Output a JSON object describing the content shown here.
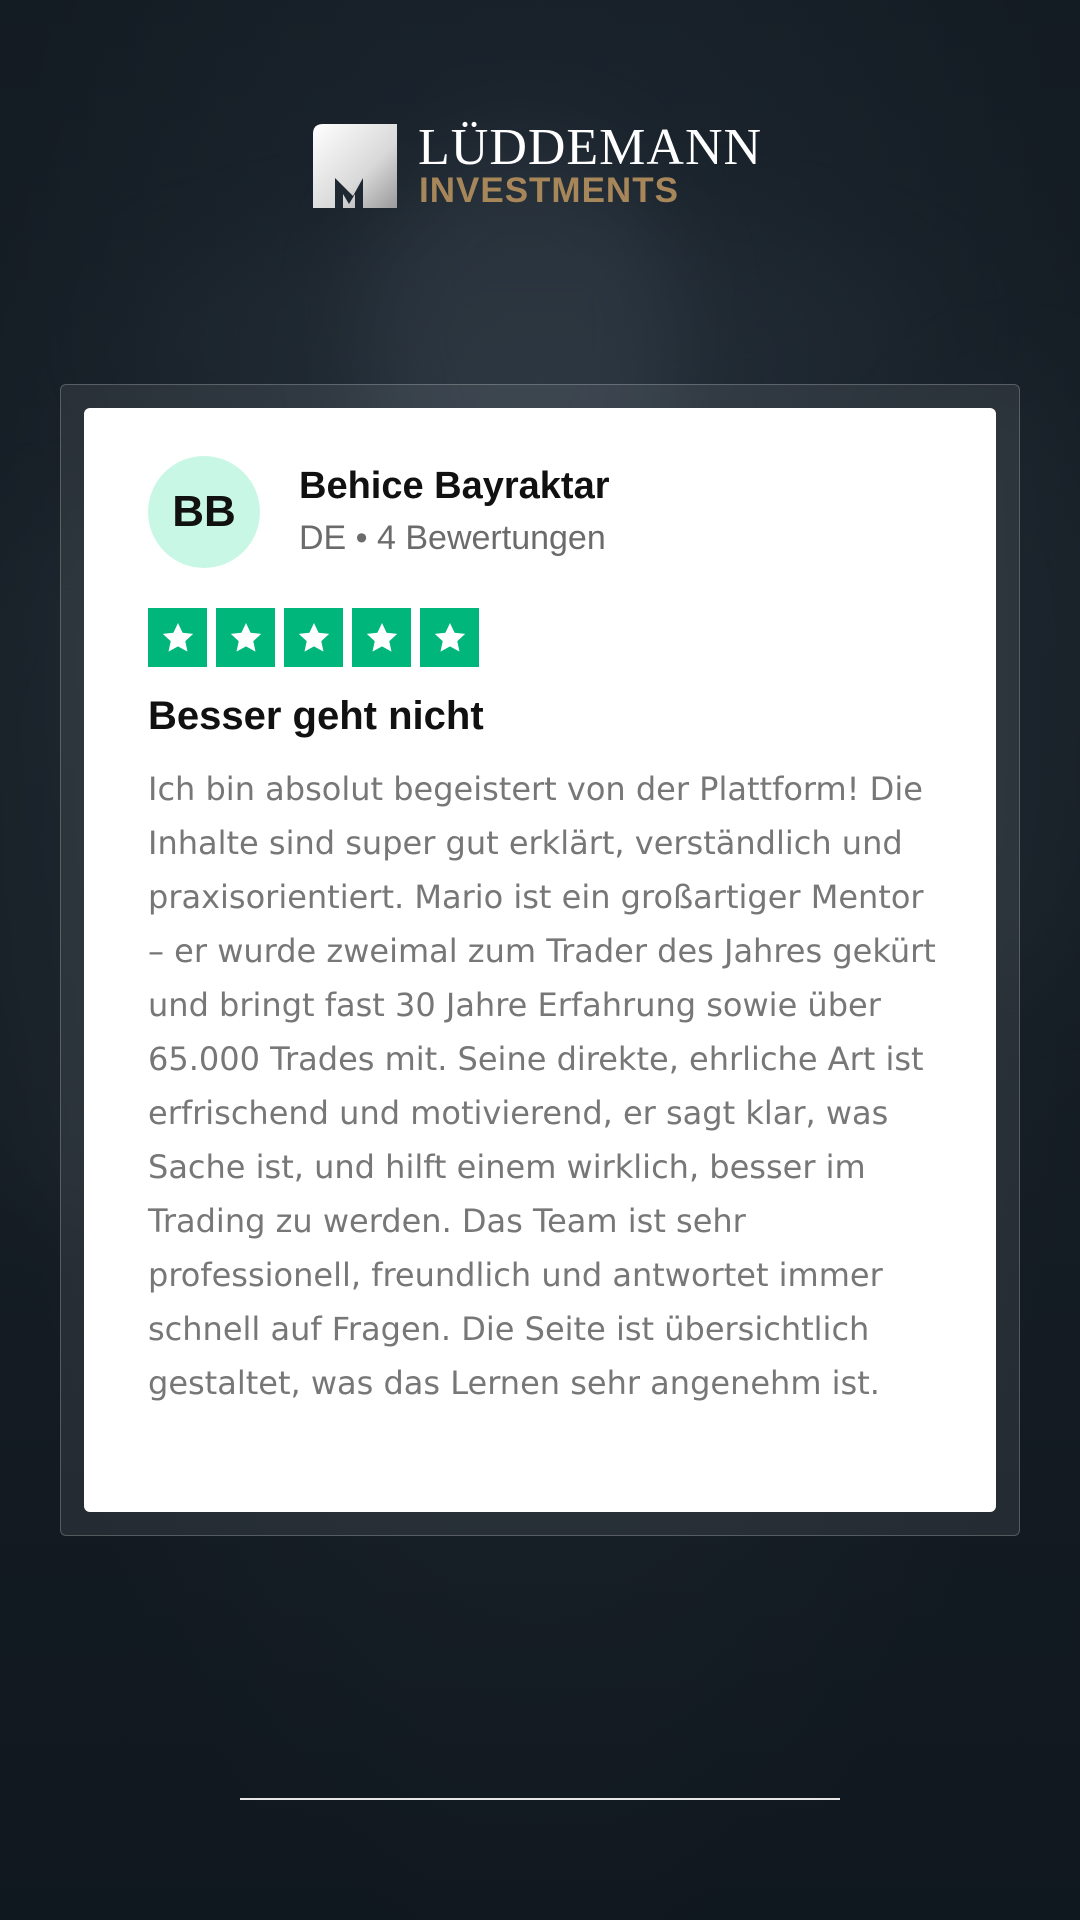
{
  "brand": {
    "name": "LÜDDEMANN",
    "subline": "INVESTMENTS",
    "accent_color": "#a7875a"
  },
  "review": {
    "avatar_initials": "BB",
    "reviewer_name": "Behice Bayraktar",
    "reviewer_meta": "DE • 4 Bewertungen",
    "rating": 5,
    "rating_max": 5,
    "star_color": "#00b67a",
    "title": "Besser geht nicht",
    "body": "Ich bin absolut begeistert von der Plattform! Die Inhalte sind super gut erklärt, verständlich und praxisorientiert. Mario ist ein großartiger Mentor – er wurde zweimal zum Trader des Jahres gekürt und bringt fast 30 Jahre Erfahrung sowie über 65.000 Trades mit. Seine direkte, ehrliche Art ist erfrischend und motivierend, er sagt klar, was Sache ist, und hilft einem wirklich, besser im Trading zu werden. Das Team ist sehr professionell, freundlich und antwortet immer schnell auf Fragen. Die Seite ist übersichtlich gestaltet, was das Lernen sehr angenehm ist."
  }
}
